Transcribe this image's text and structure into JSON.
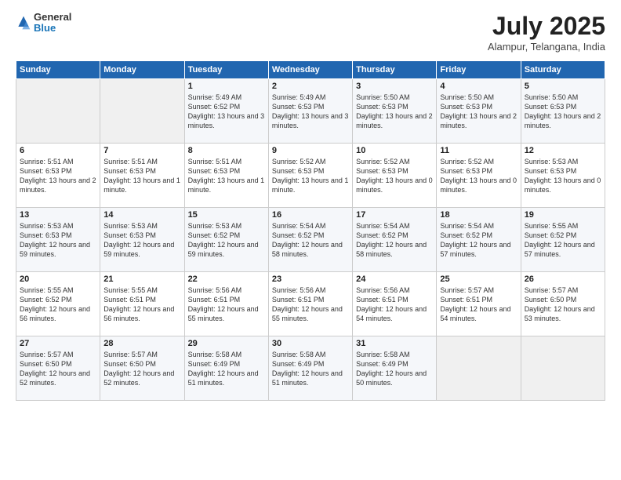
{
  "logo": {
    "line1": "General",
    "line2": "Blue"
  },
  "title": "July 2025",
  "subtitle": "Alampur, Telangana, India",
  "weekdays": [
    "Sunday",
    "Monday",
    "Tuesday",
    "Wednesday",
    "Thursday",
    "Friday",
    "Saturday"
  ],
  "weeks": [
    [
      {
        "day": "",
        "sunrise": "",
        "sunset": "",
        "daylight": ""
      },
      {
        "day": "",
        "sunrise": "",
        "sunset": "",
        "daylight": ""
      },
      {
        "day": "1",
        "sunrise": "Sunrise: 5:49 AM",
        "sunset": "Sunset: 6:52 PM",
        "daylight": "Daylight: 13 hours and 3 minutes."
      },
      {
        "day": "2",
        "sunrise": "Sunrise: 5:49 AM",
        "sunset": "Sunset: 6:53 PM",
        "daylight": "Daylight: 13 hours and 3 minutes."
      },
      {
        "day": "3",
        "sunrise": "Sunrise: 5:50 AM",
        "sunset": "Sunset: 6:53 PM",
        "daylight": "Daylight: 13 hours and 2 minutes."
      },
      {
        "day": "4",
        "sunrise": "Sunrise: 5:50 AM",
        "sunset": "Sunset: 6:53 PM",
        "daylight": "Daylight: 13 hours and 2 minutes."
      },
      {
        "day": "5",
        "sunrise": "Sunrise: 5:50 AM",
        "sunset": "Sunset: 6:53 PM",
        "daylight": "Daylight: 13 hours and 2 minutes."
      }
    ],
    [
      {
        "day": "6",
        "sunrise": "Sunrise: 5:51 AM",
        "sunset": "Sunset: 6:53 PM",
        "daylight": "Daylight: 13 hours and 2 minutes."
      },
      {
        "day": "7",
        "sunrise": "Sunrise: 5:51 AM",
        "sunset": "Sunset: 6:53 PM",
        "daylight": "Daylight: 13 hours and 1 minute."
      },
      {
        "day": "8",
        "sunrise": "Sunrise: 5:51 AM",
        "sunset": "Sunset: 6:53 PM",
        "daylight": "Daylight: 13 hours and 1 minute."
      },
      {
        "day": "9",
        "sunrise": "Sunrise: 5:52 AM",
        "sunset": "Sunset: 6:53 PM",
        "daylight": "Daylight: 13 hours and 1 minute."
      },
      {
        "day": "10",
        "sunrise": "Sunrise: 5:52 AM",
        "sunset": "Sunset: 6:53 PM",
        "daylight": "Daylight: 13 hours and 0 minutes."
      },
      {
        "day": "11",
        "sunrise": "Sunrise: 5:52 AM",
        "sunset": "Sunset: 6:53 PM",
        "daylight": "Daylight: 13 hours and 0 minutes."
      },
      {
        "day": "12",
        "sunrise": "Sunrise: 5:53 AM",
        "sunset": "Sunset: 6:53 PM",
        "daylight": "Daylight: 13 hours and 0 minutes."
      }
    ],
    [
      {
        "day": "13",
        "sunrise": "Sunrise: 5:53 AM",
        "sunset": "Sunset: 6:53 PM",
        "daylight": "Daylight: 12 hours and 59 minutes."
      },
      {
        "day": "14",
        "sunrise": "Sunrise: 5:53 AM",
        "sunset": "Sunset: 6:53 PM",
        "daylight": "Daylight: 12 hours and 59 minutes."
      },
      {
        "day": "15",
        "sunrise": "Sunrise: 5:53 AM",
        "sunset": "Sunset: 6:52 PM",
        "daylight": "Daylight: 12 hours and 59 minutes."
      },
      {
        "day": "16",
        "sunrise": "Sunrise: 5:54 AM",
        "sunset": "Sunset: 6:52 PM",
        "daylight": "Daylight: 12 hours and 58 minutes."
      },
      {
        "day": "17",
        "sunrise": "Sunrise: 5:54 AM",
        "sunset": "Sunset: 6:52 PM",
        "daylight": "Daylight: 12 hours and 58 minutes."
      },
      {
        "day": "18",
        "sunrise": "Sunrise: 5:54 AM",
        "sunset": "Sunset: 6:52 PM",
        "daylight": "Daylight: 12 hours and 57 minutes."
      },
      {
        "day": "19",
        "sunrise": "Sunrise: 5:55 AM",
        "sunset": "Sunset: 6:52 PM",
        "daylight": "Daylight: 12 hours and 57 minutes."
      }
    ],
    [
      {
        "day": "20",
        "sunrise": "Sunrise: 5:55 AM",
        "sunset": "Sunset: 6:52 PM",
        "daylight": "Daylight: 12 hours and 56 minutes."
      },
      {
        "day": "21",
        "sunrise": "Sunrise: 5:55 AM",
        "sunset": "Sunset: 6:51 PM",
        "daylight": "Daylight: 12 hours and 56 minutes."
      },
      {
        "day": "22",
        "sunrise": "Sunrise: 5:56 AM",
        "sunset": "Sunset: 6:51 PM",
        "daylight": "Daylight: 12 hours and 55 minutes."
      },
      {
        "day": "23",
        "sunrise": "Sunrise: 5:56 AM",
        "sunset": "Sunset: 6:51 PM",
        "daylight": "Daylight: 12 hours and 55 minutes."
      },
      {
        "day": "24",
        "sunrise": "Sunrise: 5:56 AM",
        "sunset": "Sunset: 6:51 PM",
        "daylight": "Daylight: 12 hours and 54 minutes."
      },
      {
        "day": "25",
        "sunrise": "Sunrise: 5:57 AM",
        "sunset": "Sunset: 6:51 PM",
        "daylight": "Daylight: 12 hours and 54 minutes."
      },
      {
        "day": "26",
        "sunrise": "Sunrise: 5:57 AM",
        "sunset": "Sunset: 6:50 PM",
        "daylight": "Daylight: 12 hours and 53 minutes."
      }
    ],
    [
      {
        "day": "27",
        "sunrise": "Sunrise: 5:57 AM",
        "sunset": "Sunset: 6:50 PM",
        "daylight": "Daylight: 12 hours and 52 minutes."
      },
      {
        "day": "28",
        "sunrise": "Sunrise: 5:57 AM",
        "sunset": "Sunset: 6:50 PM",
        "daylight": "Daylight: 12 hours and 52 minutes."
      },
      {
        "day": "29",
        "sunrise": "Sunrise: 5:58 AM",
        "sunset": "Sunset: 6:49 PM",
        "daylight": "Daylight: 12 hours and 51 minutes."
      },
      {
        "day": "30",
        "sunrise": "Sunrise: 5:58 AM",
        "sunset": "Sunset: 6:49 PM",
        "daylight": "Daylight: 12 hours and 51 minutes."
      },
      {
        "day": "31",
        "sunrise": "Sunrise: 5:58 AM",
        "sunset": "Sunset: 6:49 PM",
        "daylight": "Daylight: 12 hours and 50 minutes."
      },
      {
        "day": "",
        "sunrise": "",
        "sunset": "",
        "daylight": ""
      },
      {
        "day": "",
        "sunrise": "",
        "sunset": "",
        "daylight": ""
      }
    ]
  ]
}
